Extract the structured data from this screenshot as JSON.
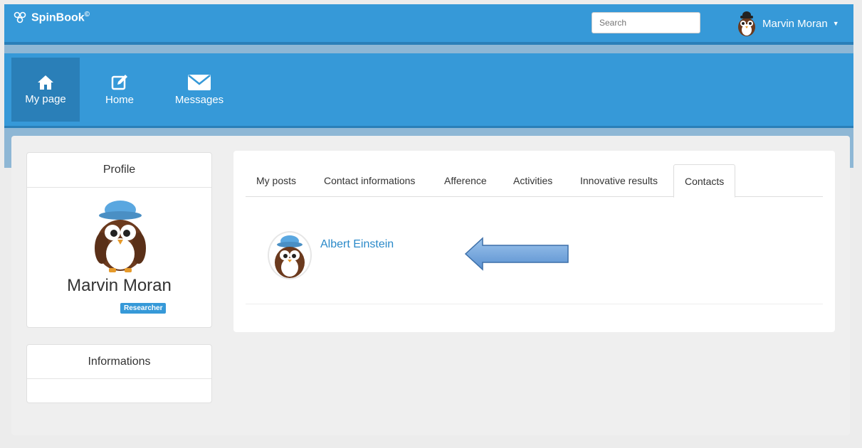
{
  "header": {
    "brand": "SpinBook",
    "brand_mark": "©",
    "search_placeholder": "Search",
    "user_name": "Marvin Moran"
  },
  "nav": {
    "items": [
      {
        "label": "My page",
        "icon": "home-icon",
        "active": true
      },
      {
        "label": "Home",
        "icon": "edit-icon",
        "active": false
      },
      {
        "label": "Messages",
        "icon": "envelope-icon",
        "active": false
      }
    ]
  },
  "profile": {
    "title": "Profile",
    "name": "Marvin Moran",
    "role": "Researcher"
  },
  "informations": {
    "title": "Informations"
  },
  "tabs": [
    {
      "label": "My posts",
      "active": false
    },
    {
      "label": "Contact informations",
      "active": false
    },
    {
      "label": "Afference",
      "active": false
    },
    {
      "label": "Activities",
      "active": false
    },
    {
      "label": "Innovative results",
      "active": false
    },
    {
      "label": "Contacts",
      "active": true
    }
  ],
  "contacts": [
    {
      "name": "Albert Einstein"
    }
  ],
  "colors": {
    "primary": "#3699d8",
    "primary_dark": "#2a7fb8",
    "link": "#2a89c9",
    "owl_brown": "#6b3a1e",
    "hat_blue": "#5aa7e0"
  }
}
